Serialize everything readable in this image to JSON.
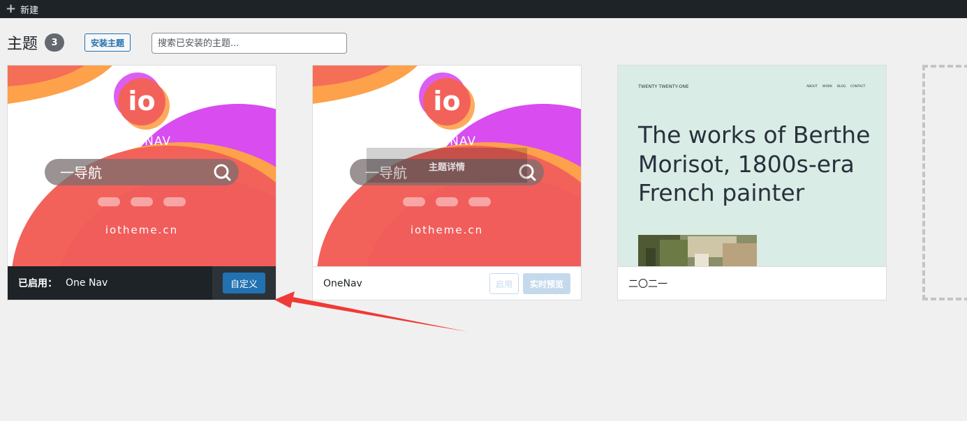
{
  "admin_bar": {
    "new_label": "新建"
  },
  "header": {
    "title": "主题",
    "count": "3",
    "add_button": "安装主题",
    "search_placeholder": "搜索已安装的主题..."
  },
  "themes": [
    {
      "name": "One Nav",
      "active_label": "已启用：",
      "customize_label": "自定义",
      "screenshot": {
        "logo_text": "io",
        "brand": "ONE NAV",
        "search_text": "一导航",
        "site": "iotheme.cn"
      }
    },
    {
      "name": "OneNav",
      "activate_label": "启用",
      "preview_label": "实时预览",
      "details_label": "主题详情",
      "screenshot": {
        "logo_text": "io",
        "brand": "ONE NAV",
        "search_text": "一导航",
        "site": "iotheme.cn"
      }
    },
    {
      "name": "二〇二一",
      "screenshot": {
        "site_title": "TWENTY TWENTY-ONE",
        "nav": [
          "ABOUT",
          "WORK",
          "BLOG",
          "CONTACT"
        ],
        "headline": [
          "The works of Berthe",
          "Morisot, 1800s-era",
          "French painter"
        ]
      }
    }
  ],
  "colors": {
    "accent": "#2271b1",
    "admin_bar": "#1d2327",
    "annotation_arrow": "#f03a35",
    "onenav_coral": "#f2625a",
    "onenav_purple": "#d84cf0",
    "onenav_orange": "#fda14a",
    "twentyone_bg": "#d9ece5"
  }
}
